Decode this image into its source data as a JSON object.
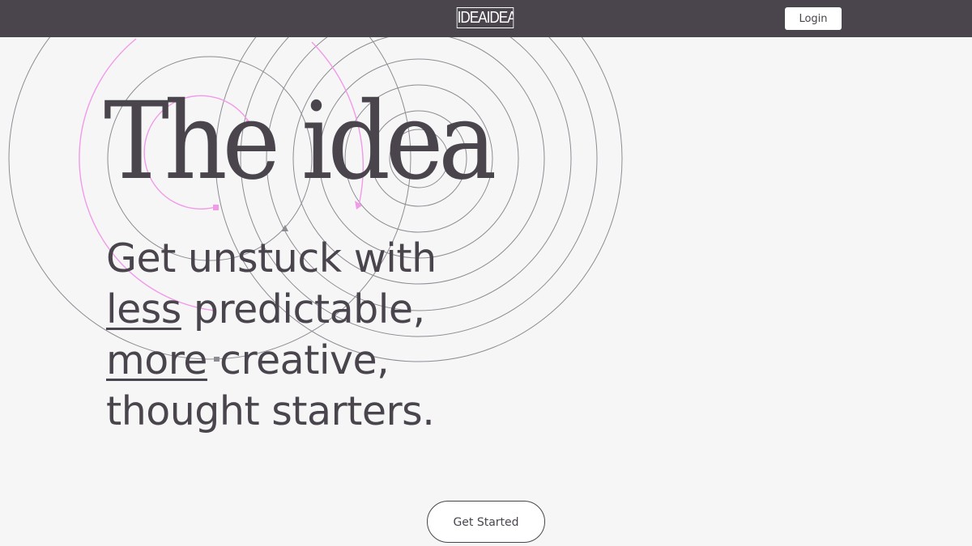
{
  "header": {
    "logo_text": "IDEAIDEA",
    "login_label": "Login"
  },
  "hero": {
    "title": "The idea",
    "subhead": {
      "line1": "Get unstuck with",
      "line2_emph": "less",
      "line2_rest": " predictable,",
      "line3_emph": "more",
      "line3_rest": " creative,",
      "line4": "thought starters."
    }
  },
  "cta": {
    "label": "Get Started"
  },
  "colors": {
    "topbar": "#4a444c",
    "background": "#f6f6f7",
    "text": "#4a454d",
    "accent_pink": "#f19ae8",
    "ring_gray": "#8f8b92"
  },
  "decor": {
    "type": "concentric-circles-background"
  }
}
